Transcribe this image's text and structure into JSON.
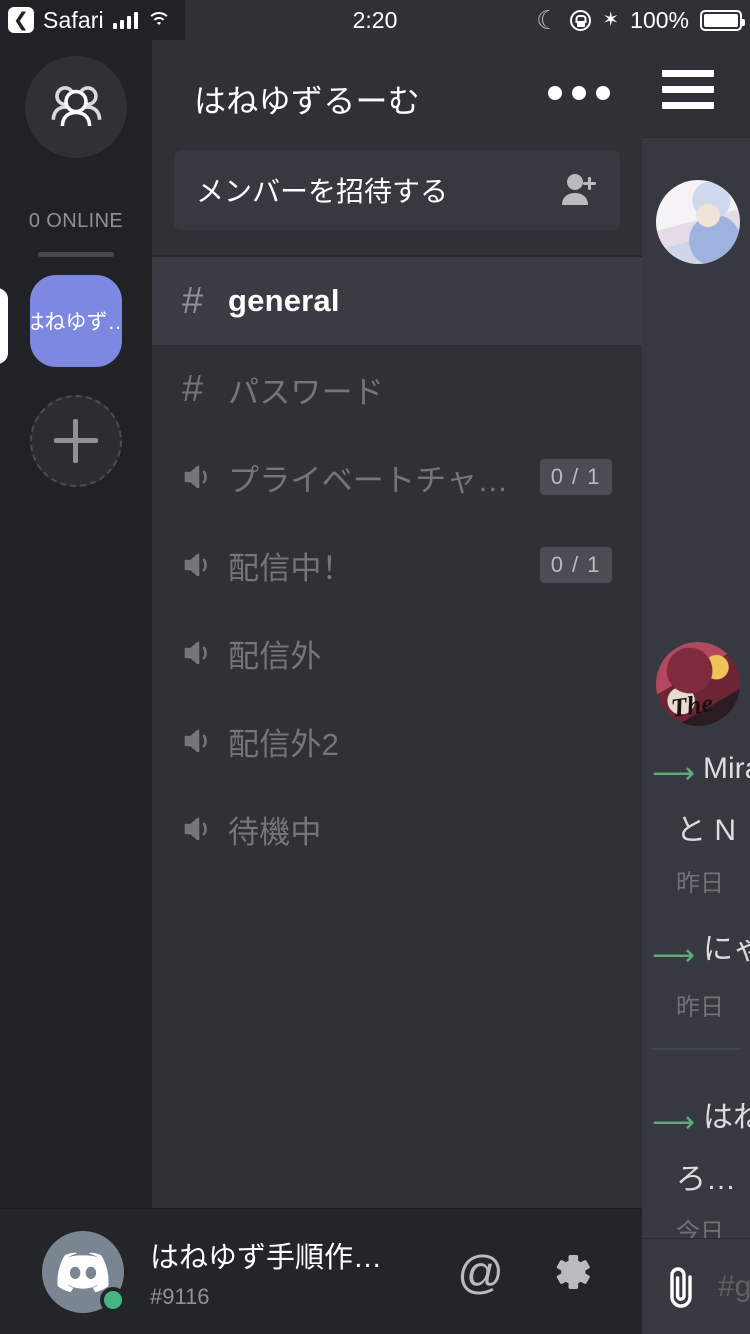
{
  "status_bar": {
    "back_app": "Safari",
    "back_icon": "chevron-left-icon",
    "signal_icon": "cellular-bars-icon",
    "wifi_icon": "wifi-icon",
    "time": "2:20",
    "moon_icon": "do-not-disturb-moon-icon",
    "lock_icon": "rotation-lock-icon",
    "bluetooth_icon": "bluetooth-icon",
    "bluetooth_glyph": "✶",
    "battery_percent": "100%",
    "battery_icon": "battery-full-icon"
  },
  "server_rail": {
    "dm_icon": "direct-messages-people-icon",
    "online_label": "0 ONLINE",
    "servers": [
      {
        "name": "はねゆず…",
        "selected": true,
        "color": "#7d89e0"
      }
    ],
    "add_server_icon": "plus-icon",
    "add_server_label": "+"
  },
  "channel_panel": {
    "server_name": "はねゆずるーむ",
    "more_icon": "ellipsis-icon",
    "invite": {
      "label": "メンバーを招待する",
      "icon": "person-add-icon"
    },
    "channels": [
      {
        "name": "general",
        "type": "text",
        "icon": "hash-icon",
        "active": true,
        "badge": ""
      },
      {
        "name": "パスワード",
        "type": "text",
        "icon": "hash-icon",
        "active": false,
        "badge": ""
      },
      {
        "name": "プライベートチャ…",
        "type": "voice",
        "icon": "speaker-icon",
        "active": false,
        "badge": "0 / 1"
      },
      {
        "name": "配信中！",
        "type": "voice",
        "icon": "speaker-icon",
        "active": false,
        "badge": "0 / 1"
      },
      {
        "name": "配信外",
        "type": "voice",
        "icon": "speaker-icon",
        "active": false,
        "badge": ""
      },
      {
        "name": "配信外2",
        "type": "voice",
        "icon": "speaker-icon",
        "active": false,
        "badge": ""
      },
      {
        "name": "待機中",
        "type": "voice",
        "icon": "speaker-icon",
        "active": false,
        "badge": ""
      }
    ]
  },
  "user_bar": {
    "avatar_icon": "discord-logo-avatar",
    "presence": "online",
    "presence_color": "#43b581",
    "username": "はねゆず手順作…",
    "discriminator": "#9116",
    "mention_icon": "at-mention-icon",
    "mention_glyph": "@",
    "settings_icon": "gear-icon"
  },
  "chat_peek": {
    "menu_icon": "hamburger-menu-icon",
    "messages": [
      {
        "avatar": "avatar-illustration-blue",
        "arrow_icon": "join-arrow-icon",
        "line1": "Mira",
        "line2": "と N",
        "time": "昨日"
      },
      {
        "arrow_icon": "join-arrow-icon",
        "line1": "にゃ",
        "line2": "",
        "time": "昨日"
      },
      {
        "avatar": "avatar-illustration-red",
        "arrow_icon": "join-arrow-icon",
        "line1": "はね",
        "line2": "ろ…",
        "time": "今日"
      }
    ],
    "input": {
      "attach_icon": "paperclip-icon",
      "placeholder": "#g"
    }
  },
  "colors": {
    "rail_bg": "#202225",
    "channel_panel_bg": "#2f3136",
    "chat_bg": "#36393f",
    "active_channel_bg": "#393c43",
    "userbar_bg": "#232528",
    "accent": "#7d89e0",
    "join_arrow": "#5fa878",
    "muted_text": "#72767d"
  }
}
